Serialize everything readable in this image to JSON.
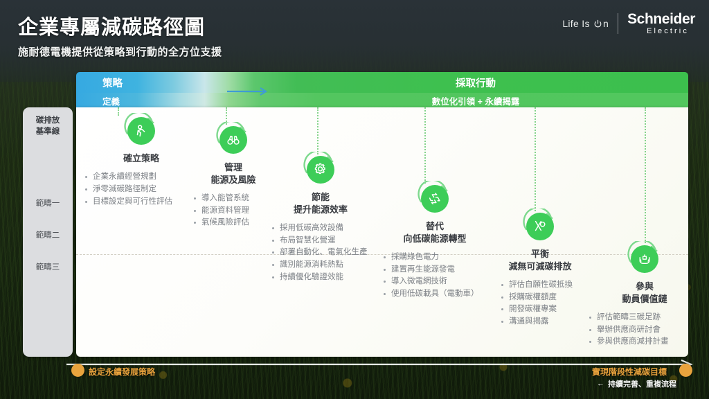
{
  "header": {
    "title": "企業專屬減碳路徑圖",
    "subtitle": "施耐德電機提供從策略到行動的全方位支援",
    "logo": {
      "tagline": "Life Is On",
      "brand": "Schneider",
      "brand_sub": "Electric"
    }
  },
  "phase_bar": {
    "strategy_title": "策略",
    "strategy_sub": "定義",
    "action_title": "採取行動",
    "action_sub": "數位化引領 + 永續揭露"
  },
  "scopes": {
    "baseline_line1": "碳排放",
    "baseline_line2": "基準線",
    "scope1": "範疇一",
    "scope2": "範疇二",
    "scope3": "範疇三"
  },
  "milestones": [
    {
      "icon": "person-strategy-icon",
      "title_line1": "確立策略",
      "title_line2": "",
      "bullets": [
        "企業永續經營規劃",
        "淨零減碳路徑制定",
        "目標設定與可行性評估"
      ]
    },
    {
      "icon": "binoculars-icon",
      "title_line1": "管理",
      "title_line2": "能源及風險",
      "bullets": [
        "導入能管系統",
        "能源資料管理",
        "氣候風險評估"
      ]
    },
    {
      "icon": "gear-icon",
      "title_line1": "節能",
      "title_line2": "提升能源效率",
      "bullets": [
        "採用低碳高效設備",
        "布局智慧化營運",
        "部署自動化、電氣化生產",
        "識別能源消耗熱點",
        "持續優化驗證效能"
      ]
    },
    {
      "icon": "recycle-energy-icon",
      "title_line1": "替代",
      "title_line2": "向低碳能源轉型",
      "bullets": [
        "採購綠色電力",
        "建置再生能源發電",
        "導入微電網技術",
        "使用低碳載具（電動車）"
      ]
    },
    {
      "icon": "balance-scale-icon",
      "title_line1": "平衡",
      "title_line2": "減無可減碳排放",
      "bullets": [
        "評估自願性碳抵換",
        "採購碳權額度",
        "開發碳權專案",
        "溝通與揭露"
      ]
    },
    {
      "icon": "hands-plant-icon",
      "title_line1": "參與",
      "title_line2": "動員價值鏈",
      "bullets": [
        "評估範疇三碳足跡",
        "舉辦供應商研討會",
        "參與供應商減排計畫"
      ]
    }
  ],
  "timeline": {
    "start_label": "設定永續發展策略",
    "end_label": "實現階段性減碳目標",
    "loop_label": "持續完善、重複流程",
    "loop_arrow": "←"
  },
  "colors": {
    "brand_green": "#3DCD58",
    "brand_blue": "#36A9E1",
    "accent_orange": "#E8A33D",
    "panel_grey": "#DCDDE0"
  }
}
